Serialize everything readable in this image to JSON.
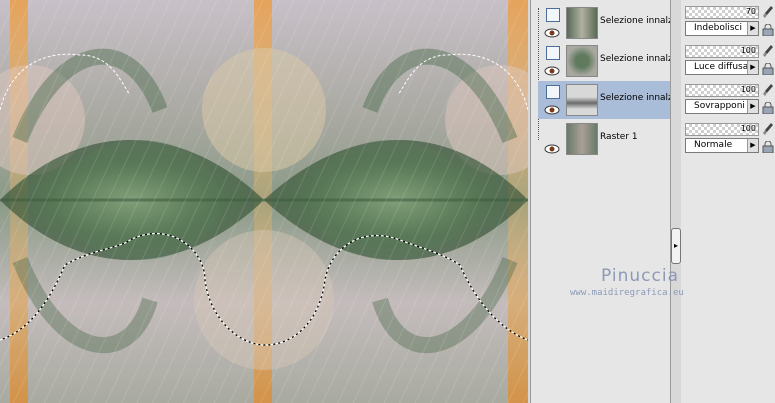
{
  "layers": [
    {
      "name": "Selezione innalza",
      "thumb": "selection-1",
      "selected": false
    },
    {
      "name": "Selezione innalza",
      "thumb": "selection-2",
      "selected": false
    },
    {
      "name": "Selezione innalza",
      "thumb": "selection-3",
      "selected": true
    },
    {
      "name": "Raster 1",
      "thumb": "raster",
      "selected": false
    }
  ],
  "properties": [
    {
      "opacity": "70",
      "blend_mode": "Indebolisci"
    },
    {
      "opacity": "100",
      "blend_mode": "Luce diffusa"
    },
    {
      "opacity": "100",
      "blend_mode": "Sovrapponi"
    },
    {
      "opacity": "100",
      "blend_mode": "Normale"
    }
  ],
  "watermark": {
    "name": "Pinuccia",
    "url": "www.maidiregrafica.eu"
  },
  "icons": {
    "visibility": "eye-icon",
    "layer_type": "raster-layer-icon",
    "brush": "brush-icon",
    "lock": "lock-icon",
    "collapse": "chevron-right-icon"
  },
  "colors": {
    "selected_row": "#a9bcd8",
    "panel_bg": "#e6e6e6",
    "watermark": "#8c9ab8"
  }
}
